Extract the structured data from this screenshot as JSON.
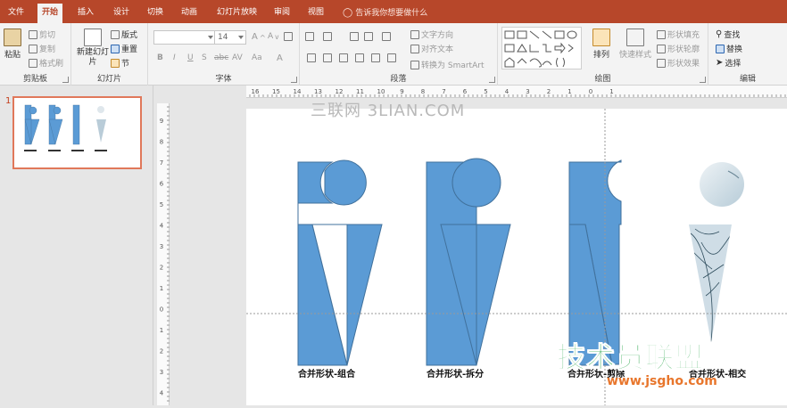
{
  "tabs": [
    "文件",
    "开始",
    "插入",
    "设计",
    "切换",
    "动画",
    "幻灯片放映",
    "审阅",
    "视图"
  ],
  "active_tab": "开始",
  "tell_me": "告诉我你想要做什么",
  "ribbon": {
    "clipboard": {
      "paste": "粘贴",
      "cut": "剪切",
      "copy": "复制",
      "format_painter": "格式刷",
      "label": "剪贴板"
    },
    "slides": {
      "new_slide": "新建幻灯片",
      "layout": "版式",
      "reset": "重置",
      "section": "节",
      "label": "幻灯片"
    },
    "font": {
      "size": "14",
      "bold": "B",
      "italic": "I",
      "underline": "U",
      "shadow": "S",
      "strike": "abc",
      "spacing": "AV",
      "case": "Aa",
      "label": "字体"
    },
    "paragraph": {
      "text_direction": "文字方向",
      "align_text": "对齐文本",
      "smartart": "转换为 SmartArt",
      "label": "段落"
    },
    "drawing": {
      "arrange": "排列",
      "quick_styles": "快速样式",
      "fill": "形状填充",
      "outline": "形状轮廓",
      "effects": "形状效果",
      "label": "绘图"
    },
    "editing": {
      "find": "查找",
      "replace": "替换",
      "select": "选择",
      "label": "编辑"
    }
  },
  "thumbnail": {
    "number": "1"
  },
  "hruler_labels": [
    "16",
    "15",
    "14",
    "13",
    "12",
    "11",
    "10",
    "9",
    "8",
    "7",
    "6",
    "5",
    "4",
    "3",
    "2",
    "1",
    "0",
    "1"
  ],
  "vruler_labels": [
    "9",
    "8",
    "7",
    "6",
    "5",
    "4",
    "3",
    "2",
    "1",
    "0",
    "1",
    "2",
    "3",
    "4"
  ],
  "captions": [
    "合并形状-组合",
    "合并形状-拆分",
    "合并形状-剪除",
    "合并形状-相交"
  ],
  "watermark": "三联网 3LIAN.COM",
  "logo": {
    "title": "技术员联盟",
    "url": "www.jsgho.com"
  },
  "colors": {
    "accent": "#b7472a",
    "shape_fill": "#5b9bd5",
    "shape_stroke": "#41719c",
    "logo_green": "#2fa84f",
    "logo_orange": "#e8762c"
  }
}
